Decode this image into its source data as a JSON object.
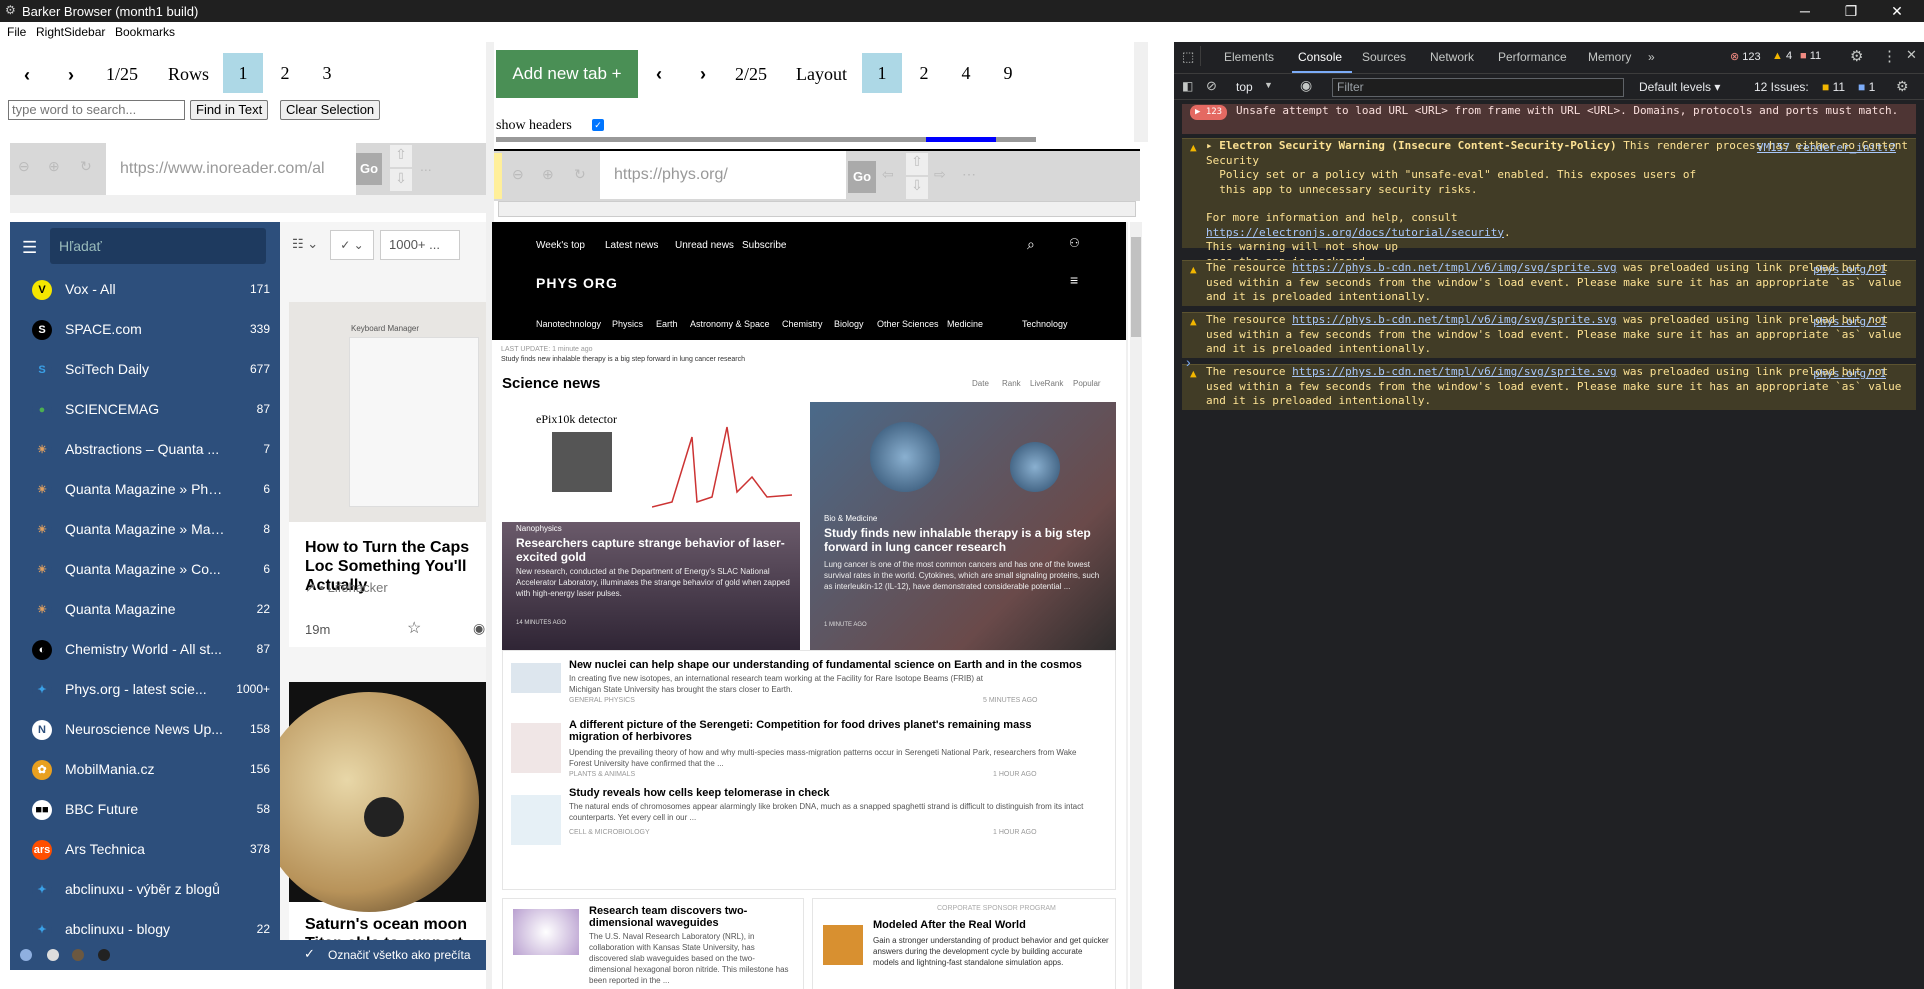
{
  "window": {
    "title": "Barker Browser (month1 build)",
    "app_icon": "gear-icon"
  },
  "menu": [
    "File",
    "RightSidebar",
    "Bookmarks"
  ],
  "left_pane": {
    "page_indicator": "1/25",
    "rows_label": "Rows",
    "pages": [
      "1",
      "2",
      "3"
    ],
    "search_placeholder": "type word to search...",
    "find_button": "Find in Text",
    "clear_button": "Clear Selection",
    "address": "https://www.inoreader.com/al",
    "go": "Go",
    "more": "..."
  },
  "inoreader": {
    "search_placeholder": "Hľadať",
    "filter_count": "1000+ ...",
    "feeds": [
      {
        "name": "Vox - All",
        "count": "171",
        "icon": "V",
        "color": "#f5e600",
        "fg": "#000"
      },
      {
        "name": "SPACE.com",
        "count": "339",
        "icon": "S",
        "color": "#000",
        "fg": "#fff"
      },
      {
        "name": "SciTech Daily",
        "count": "677",
        "icon": "S",
        "color": "#2d4f7c",
        "fg": "#3aa0e6"
      },
      {
        "name": "SCIENCEMAG",
        "count": "87",
        "icon": "●",
        "color": "#2d4f7c",
        "fg": "#4caf50"
      },
      {
        "name": "Abstractions – Quanta ...",
        "count": "7",
        "icon": "☀",
        "color": "#2d4f7c",
        "fg": "#e0a060"
      },
      {
        "name": "Quanta Magazine » Phy...",
        "count": "6",
        "icon": "☀",
        "color": "#2d4f7c",
        "fg": "#e0a060"
      },
      {
        "name": "Quanta Magazine » Mat...",
        "count": "8",
        "icon": "☀",
        "color": "#2d4f7c",
        "fg": "#e0a060"
      },
      {
        "name": "Quanta Magazine » Co...",
        "count": "6",
        "icon": "☀",
        "color": "#2d4f7c",
        "fg": "#e0a060"
      },
      {
        "name": "Quanta Magazine",
        "count": "22",
        "icon": "☀",
        "color": "#2d4f7c",
        "fg": "#e0a060"
      },
      {
        "name": "Chemistry World - All st...",
        "count": "87",
        "icon": "◐",
        "color": "#000",
        "fg": "#fff"
      },
      {
        "name": "Phys.org - latest scie...",
        "count": "1000+",
        "icon": "✦",
        "color": "#2d4f7c",
        "fg": "#3aa0e6"
      },
      {
        "name": "Neuroscience News Up...",
        "count": "158",
        "icon": "N",
        "color": "#fff",
        "fg": "#2d4f7c"
      },
      {
        "name": "MobilMania.cz",
        "count": "156",
        "icon": "✿",
        "color": "#e8a020",
        "fg": "#fff"
      },
      {
        "name": "BBC Future",
        "count": "58",
        "icon": "■■",
        "color": "#fff",
        "fg": "#000"
      },
      {
        "name": "Ars Technica",
        "count": "378",
        "icon": "ars",
        "color": "#ff4e00",
        "fg": "#fff"
      },
      {
        "name": "abclinuxu - výběr z blogů",
        "count": "",
        "icon": "✦",
        "color": "#2d4f7c",
        "fg": "#3aa0e6"
      },
      {
        "name": "abclinuxu - blogy",
        "count": "22",
        "icon": "✦",
        "color": "#2d4f7c",
        "fg": "#3aa0e6"
      }
    ],
    "mark_all": "Označiť všetko ako prečíta",
    "article1_title": "How to Turn the Caps Loc Something You'll Actually",
    "article1_source": "• Lifehacker",
    "article1_time": "19m",
    "article2_title": "Saturn's ocean moon Titan able to support life after a",
    "thumb_text": "Keyboard Manager"
  },
  "middle_pane": {
    "add_tab": "Add new tab +",
    "page_indicator": "2/25",
    "layout_label": "Layout",
    "layouts": [
      "1",
      "2",
      "4",
      "9"
    ],
    "show_headers": "show headers",
    "address": "https://phys.org/",
    "go": "Go"
  },
  "phys": {
    "top_nav": [
      "Week's top",
      "Latest news",
      "Unread news",
      "Subscribe"
    ],
    "logo": "PHYS ORG",
    "categories": [
      "Nanotechnology",
      "Physics",
      "Earth",
      "Astronomy & Space",
      "Chemistry",
      "Biology",
      "Other Sciences",
      "Medicine",
      "Technology"
    ],
    "last_update": "LAST UPDATE: 1 minute ago",
    "ticker": "Study finds new inhalable therapy is a big step forward in lung cancer research",
    "section_title": "Science news",
    "sort": [
      "Date",
      "Rank",
      "LiveRank",
      "Popular"
    ],
    "hero1": {
      "cat": "Nanophysics",
      "title": "Researchers capture strange behavior of laser-excited gold",
      "desc": "New research, conducted at the Department of Energy's SLAC National Accelerator Laboratory, illuminates the strange behavior of gold when zapped with high-energy laser pulses.",
      "time": "14 MINUTES AGO",
      "chart_label": "ePix10k detector"
    },
    "hero2": {
      "cat": "Bio & Medicine",
      "title": "Study finds new inhalable therapy is a big step forward in lung cancer research",
      "desc": "Lung cancer is one of the most common cancers and has one of the lowest survival rates in the world. Cytokines, which are small signaling proteins, such as interleukin-12 (IL-12), have demonstrated considerable potential ...",
      "time": "1 MINUTE AGO"
    },
    "articles": [
      {
        "title": "New nuclei can help shape our understanding of fundamental science on Earth and in the cosmos",
        "desc": "In creating five new isotopes, an international research team working at the Facility for Rare Isotope Beams (FRIB) at Michigan State University has brought the stars closer to Earth.",
        "cat": "GENERAL PHYSICS",
        "time": "5 MINUTES AGO"
      },
      {
        "title": "A different picture of the Serengeti: Competition for food drives planet's remaining mass migration of herbivores",
        "desc": "Upending the prevailing theory of how and why multi-species mass-migration patterns occur in Serengeti National Park, researchers from Wake Forest University have confirmed that the ...",
        "cat": "PLANTS & ANIMALS",
        "time": "1 HOUR AGO"
      },
      {
        "title": "Study reveals how cells keep telomerase in check",
        "desc": "The natural ends of chromosomes appear alarmingly like broken DNA, much as a snapped spaghetti strand is difficult to distinguish from its intact counterparts. Yet every cell in our ...",
        "cat": "CELL & MICROBIOLOGY",
        "time": "1 HOUR AGO"
      }
    ],
    "bottom1": {
      "title": "Research team discovers two-dimensional waveguides",
      "desc": "The U.S. Naval Research Laboratory (NRL), in collaboration with Kansas State University, has discovered slab waveguides based on the two-dimensional hexagonal boron nitride. This milestone has been reported in the ..."
    },
    "bottom2": {
      "label": "CORPORATE SPONSOR PROGRAM",
      "title": "Modeled After the Real World",
      "desc": "Gain a stronger understanding of product behavior and get quicker answers during the development cycle by building accurate models and lightning-fast standalone simulation apps."
    }
  },
  "devtools": {
    "tabs": [
      "Elements",
      "Console",
      "Sources",
      "Network",
      "Performance",
      "Memory"
    ],
    "errors": "123",
    "warnings": "4",
    "info": "11",
    "context": "top",
    "filter_placeholder": "Filter",
    "levels": "Default levels",
    "issues_label": "12 Issues:",
    "issues_warn": "11",
    "issues_info": "1",
    "error_count": "123",
    "error_msg": "Unsafe attempt to load URL <URL> from frame with URL <URL>. Domains, protocols and ports must match.",
    "sec_title": "Electron Security Warning (Insecure Content-Security-Policy)",
    "sec_rest1": " This renderer process has either no Content Security",
    "sec_rest2": "  Policy set or a policy with \"unsafe-eval\" enabled. This exposes users of",
    "sec_rest3": "  this app to unnecessary security risks.",
    "sec_more": "For more information and help, consult",
    "sec_link": "https://electronjs.org/docs/tutorial/security",
    "sec_tail1": "This warning will not show up",
    "sec_tail2": "once the app is packaged.",
    "sec_src": "VM157 renderer_init:2",
    "res_prefix": "The resource ",
    "res_link": "https://phys.b-cdn.net/tmpl/v6/img/svg/sprite.svg",
    "res_mid": " was preloaded using link",
    "res_rest": "preload but not used within a few seconds from the window's load event. Please make sure it has an appropriate `as` value and it is preloaded intentionally.",
    "res_src": "phys.org/:1",
    "prompt": "›"
  }
}
